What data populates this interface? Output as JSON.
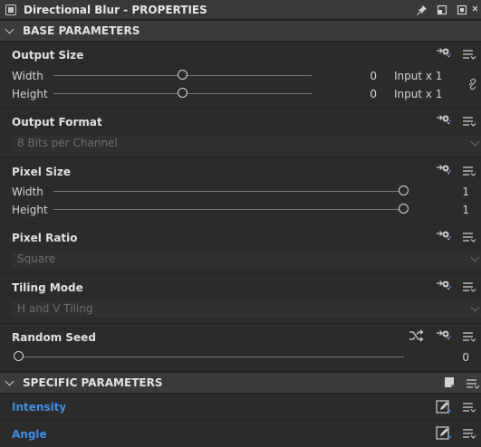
{
  "window": {
    "title": "Directional Blur - PROPERTIES"
  },
  "sections": {
    "base": {
      "title": "BASE PARAMETERS"
    },
    "specific": {
      "title": "SPECIFIC PARAMETERS"
    }
  },
  "output_size": {
    "label": "Output Size",
    "width": {
      "label": "Width",
      "value": "0",
      "unit": "Input x 1",
      "slider_fraction": 0.5
    },
    "height": {
      "label": "Height",
      "value": "0",
      "unit": "Input x 1",
      "slider_fraction": 0.5
    }
  },
  "output_format": {
    "label": "Output Format",
    "selected": "8 Bits per Channel"
  },
  "pixel_size": {
    "label": "Pixel Size",
    "width": {
      "label": "Width",
      "value": "1",
      "slider_fraction": 1.0
    },
    "height": {
      "label": "Height",
      "value": "1",
      "slider_fraction": 1.0
    }
  },
  "pixel_ratio": {
    "label": "Pixel Ratio",
    "selected": "Square"
  },
  "tiling_mode": {
    "label": "Tiling Mode",
    "selected": "H and V Tiling"
  },
  "random_seed": {
    "label": "Random Seed",
    "value": "0",
    "slider_fraction": 0.0
  },
  "intensity": {
    "label": "Intensity"
  },
  "angle": {
    "label": "Angle"
  },
  "icons": {
    "title": "panel-icon",
    "pin": "pin-icon",
    "restore": "restore-icon",
    "maximize": "maximize-icon",
    "close": "close-icon",
    "inheritance": "inheritance-icon",
    "menu": "menu-icon",
    "link": "link-icon",
    "shuffle": "shuffle-icon",
    "edit": "edit-function-icon",
    "bookmark": "bookmark-icon"
  },
  "colors": {
    "accent": "#3d8ee6",
    "background": "#2b2b2b",
    "header": "#3a3a3a"
  }
}
